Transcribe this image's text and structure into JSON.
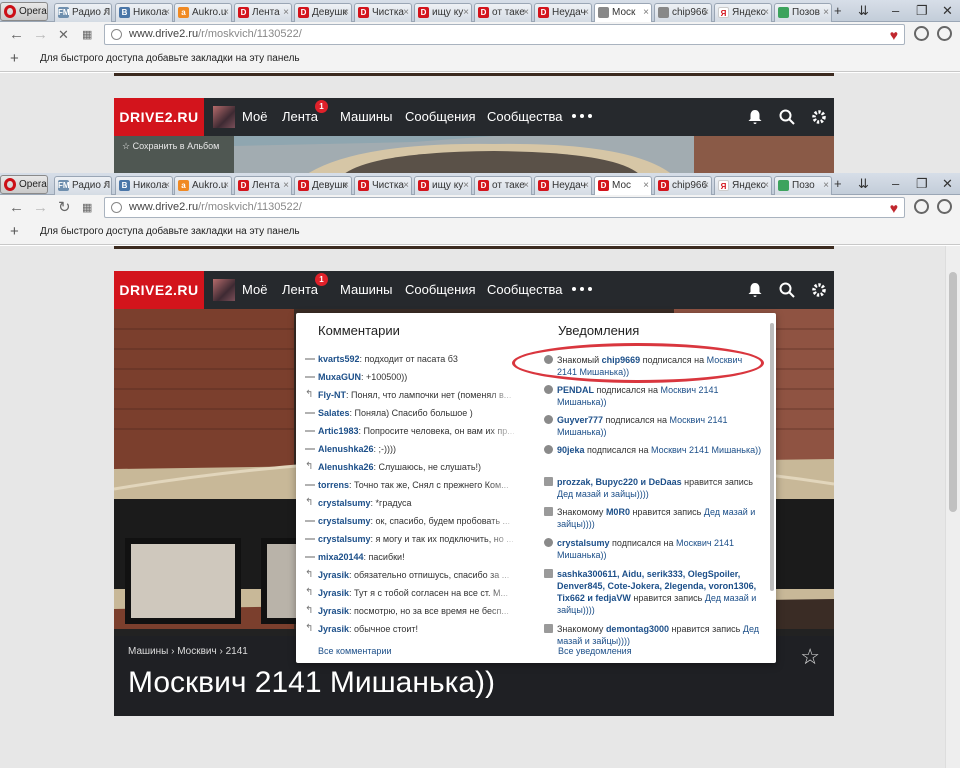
{
  "browser": {
    "opera_label": "Opera",
    "url_host": "www.drive2.ru",
    "url_path": "/r/moskvich/1130522/",
    "bookmark_hint": "Для быстрого доступа добавьте закладки на эту панель"
  },
  "tabs_back": [
    {
      "fav": "FM",
      "color": "#6f8fae",
      "title": "Радио Л"
    },
    {
      "fav": "B",
      "color": "#4a76a8",
      "title": "Никола"
    },
    {
      "fav": "a",
      "color": "#f08a24",
      "title": "Aukro.u"
    },
    {
      "fav": "D",
      "color": "#d3141c",
      "title": "Лента"
    },
    {
      "fav": "D",
      "color": "#d3141c",
      "title": "Девушк"
    },
    {
      "fav": "D",
      "color": "#d3141c",
      "title": "Чистка"
    },
    {
      "fav": "D",
      "color": "#d3141c",
      "title": "ищу ку"
    },
    {
      "fav": "D",
      "color": "#d3141c",
      "title": "от таке"
    },
    {
      "fav": "D",
      "color": "#d3141c",
      "title": "Неудач"
    },
    {
      "fav": "",
      "color": "#888888",
      "title": "Моск"
    },
    {
      "fav": "",
      "color": "#888888",
      "title": "chip966"
    },
    {
      "fav": "Я",
      "color": "#ffffff",
      "title": "Яндекс"
    },
    {
      "fav": "",
      "color": "#3da35d",
      "title": "Позов"
    }
  ],
  "tabs_front": [
    {
      "fav": "FM",
      "color": "#6f8fae",
      "title": "Радио Л"
    },
    {
      "fav": "B",
      "color": "#4a76a8",
      "title": "Никола"
    },
    {
      "fav": "a",
      "color": "#f08a24",
      "title": "Aukro.u"
    },
    {
      "fav": "D",
      "color": "#d3141c",
      "title": "Лента"
    },
    {
      "fav": "D",
      "color": "#d3141c",
      "title": "Девушк"
    },
    {
      "fav": "D",
      "color": "#d3141c",
      "title": "Чистка"
    },
    {
      "fav": "D",
      "color": "#d3141c",
      "title": "ищу ку"
    },
    {
      "fav": "D",
      "color": "#d3141c",
      "title": "от таке"
    },
    {
      "fav": "D",
      "color": "#d3141c",
      "title": "Неудач"
    },
    {
      "fav": "D",
      "color": "#d3141c",
      "title": "Мос"
    },
    {
      "fav": "D",
      "color": "#d3141c",
      "title": "chip966"
    },
    {
      "fav": "Я",
      "color": "#ffffff",
      "title": "Яндекс"
    },
    {
      "fav": "",
      "color": "#3da35d",
      "title": "Позо"
    }
  ],
  "site": {
    "logo": "DRIVE2.RU",
    "nav": {
      "mine": "Моё",
      "feed": "Лента",
      "messages": "Машины",
      "inbox": "Сообщения",
      "communities": "Сообщества"
    },
    "feed_badge": "1",
    "save_album": "Сохранить в Альбом",
    "breadcrumbs": "Машины › Москвич › 2141",
    "page_title": "Москвич 2141 Мишанька))"
  },
  "dropdown": {
    "comments_title": "Комментарии",
    "notifications_title": "Уведомления",
    "all_comments": "Все комментарии",
    "all_notifications": "Все уведомления",
    "comments": [
      {
        "reply": false,
        "user": "kvarts592",
        "text": ": подходит от пасата б3"
      },
      {
        "reply": false,
        "user": "MuxaGUN",
        "text": ": +100500))"
      },
      {
        "reply": true,
        "user": "Fly-NT",
        "text": ": Понял, что лампочки нет (поменял в..."
      },
      {
        "reply": false,
        "user": "Salates",
        "text": ": Поняла) Спасибо большое )"
      },
      {
        "reply": false,
        "user": "Artic1983",
        "text": ": Попросите человека, он вам их пр..."
      },
      {
        "reply": false,
        "user": "Alenushka26",
        "text": ": ;-))))"
      },
      {
        "reply": true,
        "user": "Alenushka26",
        "text": ": Слушаюсь, не слушать!)"
      },
      {
        "reply": false,
        "user": "torrens",
        "text": ": Точно так же, Снял с прежнего Ком..."
      },
      {
        "reply": true,
        "user": "crystalsumy",
        "text": ": *градуса"
      },
      {
        "reply": false,
        "user": "crystalsumy",
        "text": ": ок, спасибо, будем пробовать ..."
      },
      {
        "reply": false,
        "user": "crystalsumy",
        "text": ": я могу и так их подключить, но ..."
      },
      {
        "reply": false,
        "user": "mixa20144",
        "text": ": пасибки!"
      },
      {
        "reply": true,
        "user": "Jyrasik",
        "text": ": обязательно отпишусь, спасибо за ..."
      },
      {
        "reply": true,
        "user": "Jyrasik",
        "text": ": Тут я с тобой согласен на все ст. М..."
      },
      {
        "reply": true,
        "user": "Jyrasik",
        "text": ": посмотрю, но за все время не бесп..."
      },
      {
        "reply": true,
        "user": "Jyrasik",
        "text": ": обычное стоит!"
      }
    ],
    "notifications": [
      {
        "icon": "plus",
        "pre": "Знакомый ",
        "users": "chip9669",
        "mid": " подписался на ",
        "link": "Москвич 2141 Мишанька))",
        "post": ""
      },
      {
        "icon": "plus",
        "pre": "",
        "users": "PENDAL",
        "mid": " подписался на ",
        "link": "Москвич 2141 Мишанька))",
        "post": ""
      },
      {
        "icon": "plus",
        "pre": "",
        "users": "Guyver777",
        "mid": " подписался на ",
        "link": "Москвич 2141 Мишанька))",
        "post": ""
      },
      {
        "icon": "plus",
        "pre": "",
        "users": "90jeka",
        "mid": " подписался на ",
        "link": "Москвич 2141 Мишанька))",
        "post": ""
      },
      {
        "icon": "like",
        "pre": "",
        "users": "prozzak, Bupyc220 и DeDaas",
        "mid": " нравится запись ",
        "link": "Дед мазай и зайцы))))",
        "post": ""
      },
      {
        "icon": "like",
        "pre": "Знакомому ",
        "users": "M0R0",
        "mid": " нравится запись ",
        "link": "Дед мазай и зайцы))))",
        "post": ""
      },
      {
        "icon": "plus",
        "pre": "",
        "users": "crystalsumy",
        "mid": " подписался на ",
        "link": "Москвич 2141 Мишанька))",
        "post": ""
      },
      {
        "icon": "like",
        "pre": "",
        "users": "sashka300611, Aidu, serik333, OlegSpoiler, Denver845, Cote-Jokera, 2legenda, voron1306, Tix662 и fedjaVW",
        "mid": " нравится запись ",
        "link": "Дед мазай и зайцы))))",
        "post": ""
      },
      {
        "icon": "like",
        "pre": "Знакомому ",
        "users": "demontag3000",
        "mid": " нравится запись ",
        "link": "Дед мазай и зайцы))))",
        "post": ""
      }
    ]
  }
}
